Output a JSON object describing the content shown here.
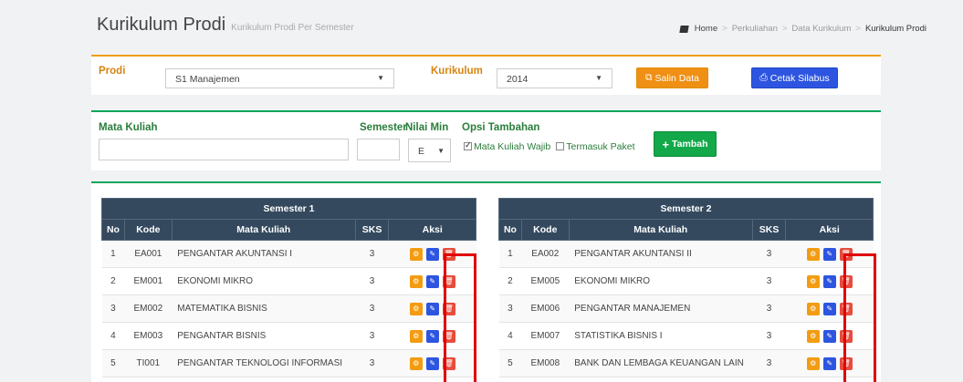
{
  "header": {
    "title": "Kurikulum Prodi",
    "subtitle": "Kurikulum Prodi Per Semester"
  },
  "breadcrumb": [
    "Home",
    "Perkuliahan",
    "Data Kurikulum",
    "Kurikulum Prodi"
  ],
  "filter": {
    "prodi_label": "Prodi",
    "prodi_value": "S1 Manajemen",
    "kurikulum_label": "Kurikulum",
    "kurikulum_value": "2014",
    "salin_label": "Salin Data",
    "cetak_label": "Cetak Silabus"
  },
  "add_form": {
    "mk_label": "Mata Kuliah",
    "semester_label": "Semester",
    "nilai_label": "Nilai Min",
    "nilai_value": "E",
    "opsi_label": "Opsi Tambahan",
    "wajib_label": "Mata Kuliah Wajib",
    "wajib_checked": true,
    "paket_label": "Termasuk Paket",
    "paket_checked": false,
    "tambah_label": "Tambah"
  },
  "columns": {
    "no": "No",
    "kode": "Kode",
    "mk": "Mata Kuliah",
    "sks": "SKS",
    "aksi": "Aksi"
  },
  "semester1": {
    "title": "Semester 1",
    "rows": [
      {
        "no": "1",
        "kode": "EA001",
        "mk": "PENGANTAR AKUNTANSI I",
        "sks": "3"
      },
      {
        "no": "2",
        "kode": "EM001",
        "mk": "EKONOMI MIKRO",
        "sks": "3"
      },
      {
        "no": "3",
        "kode": "EM002",
        "mk": "MATEMATIKA BISNIS",
        "sks": "3"
      },
      {
        "no": "4",
        "kode": "EM003",
        "mk": "PENGANTAR BISNIS",
        "sks": "3"
      },
      {
        "no": "5",
        "kode": "TI001",
        "mk": "PENGANTAR TEKNOLOGI INFORMASI",
        "sks": "3"
      }
    ]
  },
  "semester2": {
    "title": "Semester 2",
    "rows": [
      {
        "no": "1",
        "kode": "EA002",
        "mk": "PENGANTAR AKUNTANSI II",
        "sks": "3"
      },
      {
        "no": "2",
        "kode": "EM005",
        "mk": "EKONOMI MIKRO",
        "sks": "3"
      },
      {
        "no": "3",
        "kode": "EM006",
        "mk": "PENGANTAR MANAJEMEN",
        "sks": "3"
      },
      {
        "no": "4",
        "kode": "EM007",
        "mk": "STATISTIKA BISNIS I",
        "sks": "3"
      },
      {
        "no": "5",
        "kode": "EM008",
        "mk": "BANK DAN LEMBAGA KEUANGAN LAIN",
        "sks": "3"
      }
    ]
  },
  "icons": {
    "gear": "gear-icon",
    "edit": "pencil-icon",
    "delete": "trash-icon",
    "copy": "copy-icon",
    "print": "print-icon",
    "plus": "plus-icon",
    "home": "home-icon"
  },
  "colors": {
    "header_bg": "#34495e",
    "orange": "#f39c12",
    "blue": "#2d55e0",
    "red": "#e74c3c",
    "green": "#13a84a",
    "highlight": "#e00000"
  }
}
